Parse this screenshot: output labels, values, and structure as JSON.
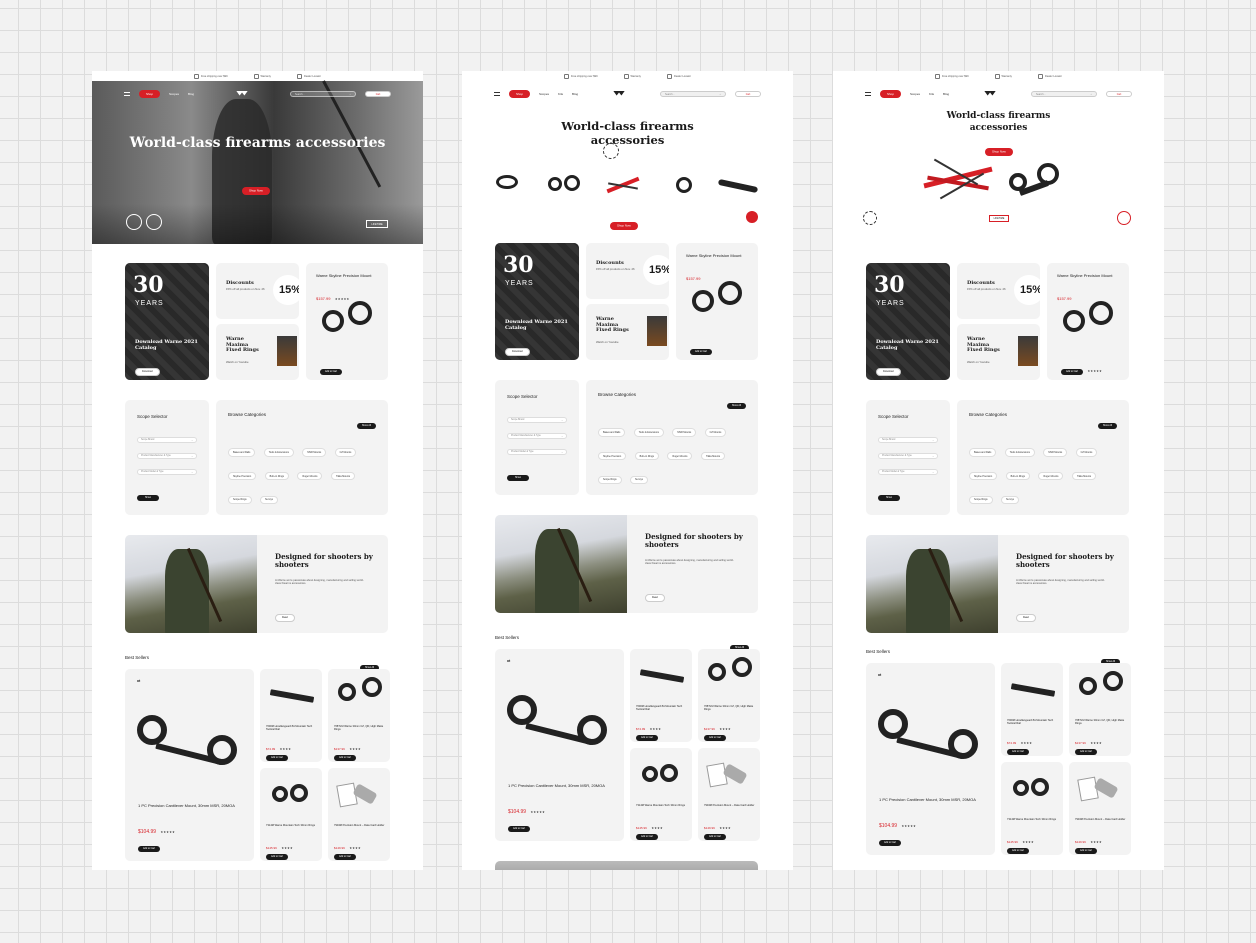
{
  "top_links": [
    "Free shipping over $99",
    "Warranty",
    "Dealer Locator"
  ],
  "nav": {
    "shop": "Shop",
    "links": [
      "Scopes",
      "Kits",
      "Blog"
    ],
    "search_placeholder": "Search...",
    "cart": "Cart"
  },
  "hero": {
    "title": "World-class firearms accessories",
    "cta": "Shop Now"
  },
  "promo": {
    "catalog_years": "30",
    "catalog_years_word": "YEARS",
    "catalog_title": "Download Warne 2021 Catalog",
    "catalog_button": "Download",
    "discount_title": "Discounts",
    "discount_text": "15% off all products on Nov. 26",
    "discount_value": "15%",
    "rings_title": "Warne Maxima Fixed Rings",
    "rings_link": "Watch on Youtube",
    "mount_title": "Warne Skyline Precision Mount",
    "mount_price": "$157.99",
    "mount_stars": "★★★★★",
    "mount_button": "Add to Cart"
  },
  "scope_selector": {
    "title": "Scope Selector",
    "fields": [
      "Scope Brand",
      "Product Manufacturer & Type",
      "Product Model & Type"
    ],
    "button": "Show"
  },
  "categories": {
    "title": "Browse Categories",
    "button": "Show All",
    "items": [
      "Bases and Rails",
      "Tools & Extensions",
      "MSR Mounts",
      "CZ Mounts",
      "Skyline Precision",
      "Bolt-on Rings",
      "Ruger Mounts",
      "Tikka Mounts",
      "Scope Rings",
      "Sunnys"
    ]
  },
  "story": {
    "title": "Designed for shooters by shooters",
    "text": "At Warne we're passionate about designing, manufacturing and selling world-class firearms accessories.",
    "button": "Read"
  },
  "best": {
    "title": "Best Sellers",
    "button": "Show All",
    "main": {
      "name": "1 PC Precision Cantilever Mount, 30mm MSR, 20MOA",
      "price": "$104.99",
      "stars": "★★★★★",
      "button": "Add to Cart"
    },
    "items": [
      {
        "name": "7600M Hoodlanguard 8A Mountain Tech Tactical Rail",
        "price": "$74.99",
        "stars": "★★★★",
        "button": "Add to Cart"
      },
      {
        "name": "768TLM Warne 30mm CZ, QD, High Matte Rings",
        "price": "$137.99",
        "stars": "★★★★",
        "button": "Add to Cart"
      },
      {
        "name": "7314M Warne Mountain Tech 30mm Rings",
        "price": "$145.99",
        "stars": "★★★★",
        "button": "Add to Cart"
      },
      {
        "name": "7904M Precision Mount – Data Card Holder",
        "price": "$149.99",
        "stars": "★★★★",
        "button": "Add to Cart"
      }
    ]
  },
  "colors": {
    "accent": "#d71f26",
    "dark": "#1a1a1a"
  }
}
